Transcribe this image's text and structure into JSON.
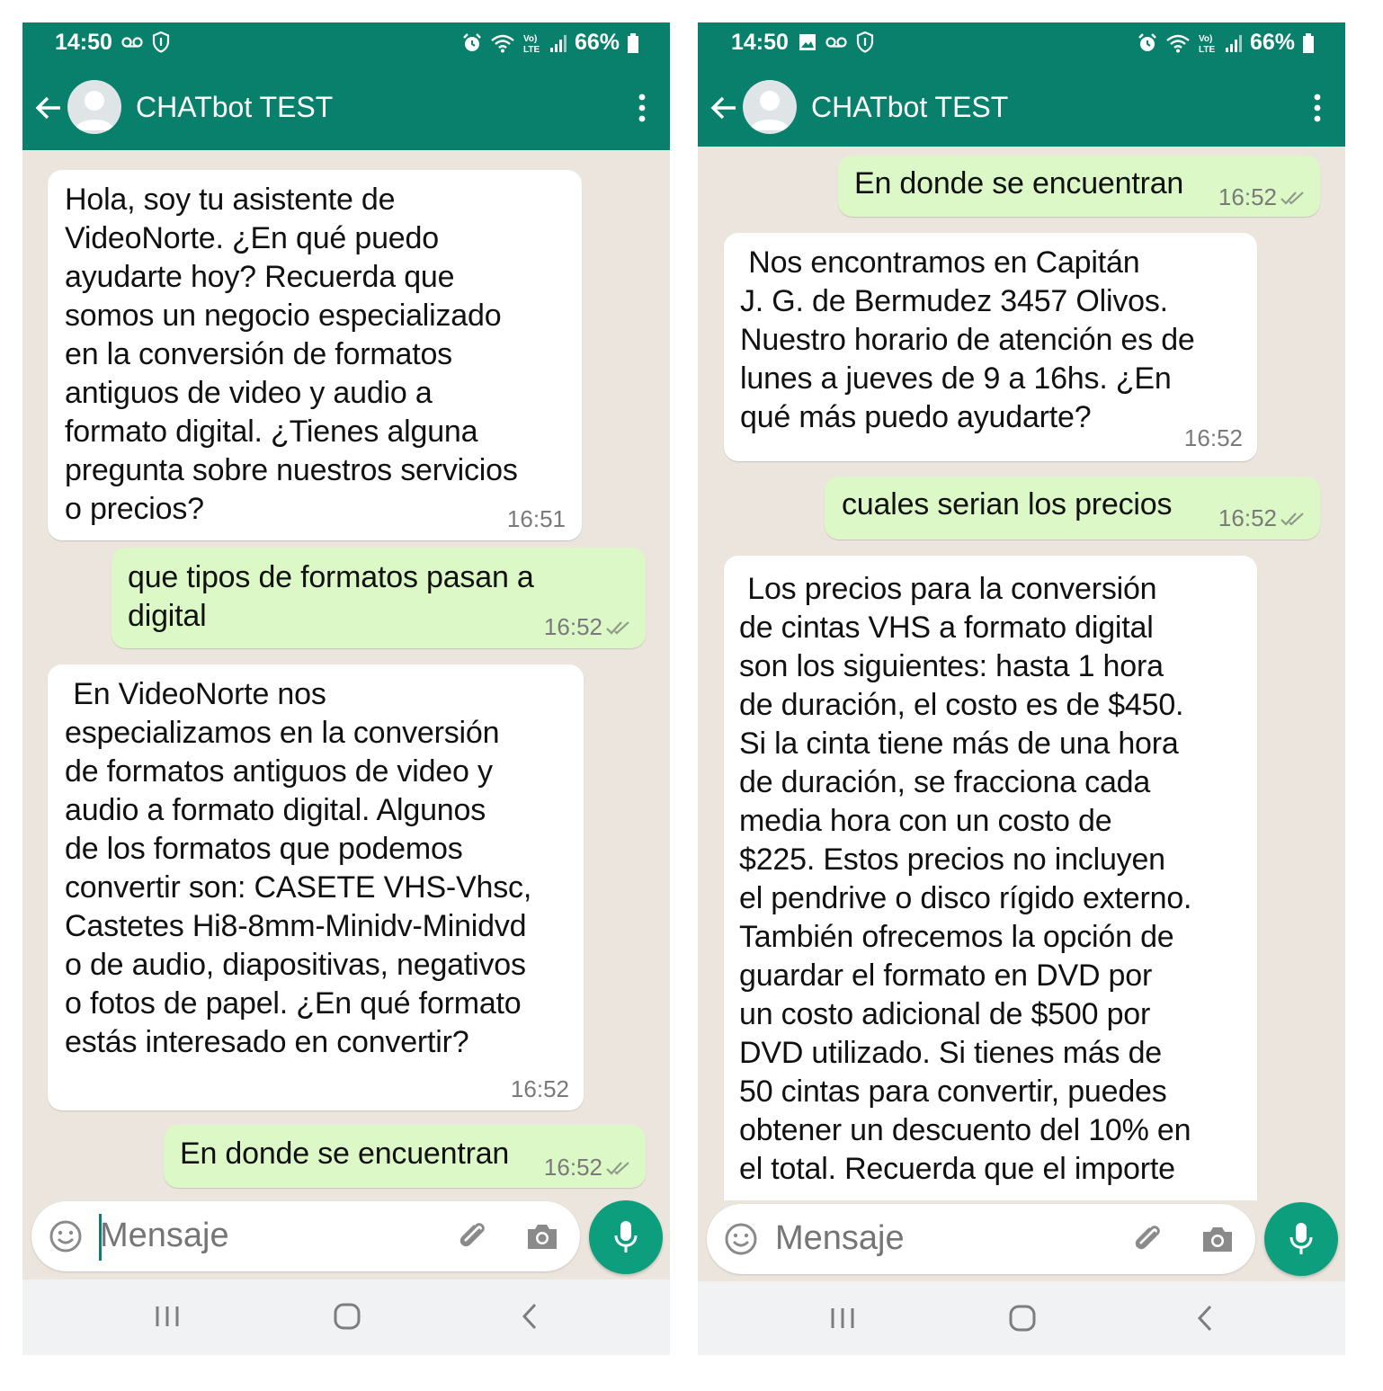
{
  "colors": {
    "header": "#08806c",
    "chat_background": "#ece5dd",
    "incoming_bubble": "#ffffff",
    "outgoing_bubble": "#dcf8c6",
    "mic_button": "#0d9e7e"
  },
  "left": {
    "status": {
      "time": "14:50",
      "battery": "66%"
    },
    "header": {
      "title": "CHATbot TEST"
    },
    "messages": [
      {
        "text": "Hola, soy tu asistente de\nVideoNorte. ¿En qué puedo\nayudarte hoy? Recuerda que\nsomos un negocio especializado\nen la conversión de formatos\nantiguos de video y audio a\nformato digital. ¿Tienes alguna\npregunta sobre nuestros servicios\no precios?",
        "time": "16:51"
      },
      {
        "text": "que tipos de formatos pasan a\ndigital",
        "time": "16:52"
      },
      {
        "text": " En VideoNorte nos\nespecializamos en la conversión\nde formatos antiguos de video y\naudio a formato digital. Algunos\nde los formatos que podemos\nconvertir son: CASETE VHS-Vhsc,\nCastetes Hi8-8mm-Minidv-Minidvd\no de audio, diapositivas, negativos\no fotos de papel. ¿En qué formato\nestás interesado en convertir?",
        "time": "16:52"
      },
      {
        "text": "En donde se encuentran",
        "time": "16:52"
      }
    ],
    "composer": {
      "placeholder": "Mensaje"
    }
  },
  "right": {
    "status": {
      "time": "14:50",
      "battery": "66%"
    },
    "header": {
      "title": "CHATbot TEST"
    },
    "messages": [
      {
        "text": "En donde se encuentran",
        "time": "16:52"
      },
      {
        "text": " Nos encontramos en Capitán\nJ. G. de Bermudez 3457 Olivos.\nNuestro horario de atención es de\nlunes a jueves de 9 a 16hs. ¿En\nqué más puedo ayudarte?",
        "time": "16:52"
      },
      {
        "text": "cuales serian los precios",
        "time": "16:52"
      },
      {
        "text": " Los precios para la conversión\nde cintas VHS a formato digital\nson los siguientes: hasta 1 hora\nde duración, el costo es de $450.\nSi la cinta tiene más de una hora\nde duración, se fracciona cada\nmedia hora con un costo de\n$225. Estos precios no incluyen\nel pendrive o disco rígido externo.\nTambién ofrecemos la opción de\nguardar el formato en DVD por\nun costo adicional de $500 por\nDVD utilizado. Si tienes más de\n50 cintas para convertir, puedes\nobtener un descuento del 10% en\nel total. Recuerda que el importe",
        "time": ""
      }
    ],
    "composer": {
      "placeholder": "Mensaje"
    }
  },
  "icons": {
    "back": "arrow-left-icon",
    "avatar": "default-avatar-icon",
    "menu": "more-vertical-icon",
    "emoji": "smiley-icon",
    "attach": "paperclip-icon",
    "camera": "camera-icon",
    "mic": "microphone-icon",
    "scroll_down": "double-chevron-down-icon",
    "nav_recent": "recent-apps-icon",
    "nav_home": "home-icon",
    "nav_back": "nav-back-icon"
  }
}
